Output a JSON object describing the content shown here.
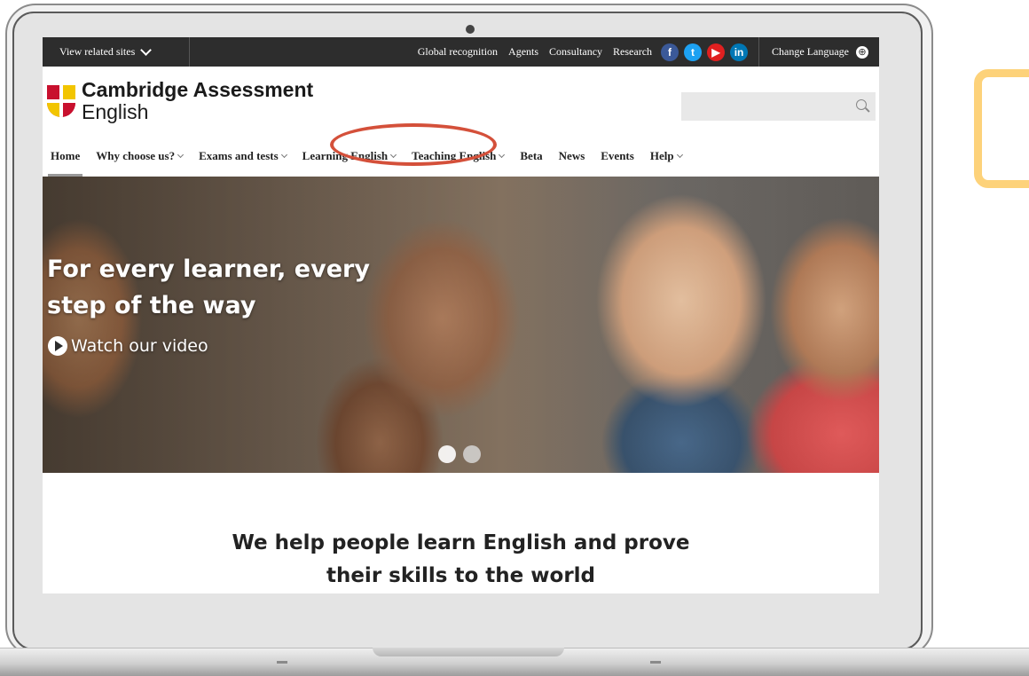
{
  "topbar": {
    "related_sites": "View related sites",
    "links": [
      "Global recognition",
      "Agents",
      "Consultancy",
      "Research"
    ],
    "social": {
      "facebook": "f",
      "twitter": "t",
      "youtube": "▶",
      "linkedin": "in"
    },
    "change_language": "Change Language"
  },
  "brand": {
    "line1": "Cambridge Assessment",
    "line2": "English"
  },
  "search": {
    "placeholder": ""
  },
  "nav": {
    "items": [
      {
        "label": "Home"
      },
      {
        "label": "Why choose us?"
      },
      {
        "label": "Exams and tests"
      },
      {
        "label": "Learning English"
      },
      {
        "label": "Teaching English"
      },
      {
        "label": "Beta"
      },
      {
        "label": "News"
      },
      {
        "label": "Events"
      },
      {
        "label": "Help"
      }
    ]
  },
  "hero": {
    "title_line1": "For every learner, every",
    "title_line2": "step of the way",
    "video_link": "Watch our video"
  },
  "tagline": {
    "line1": "We help people learn English and prove",
    "line2": "their skills to the world"
  },
  "colors": {
    "highlight": "#d4503a",
    "topbar": "#2d2d2d",
    "accent_frame": "#fdd27a"
  }
}
